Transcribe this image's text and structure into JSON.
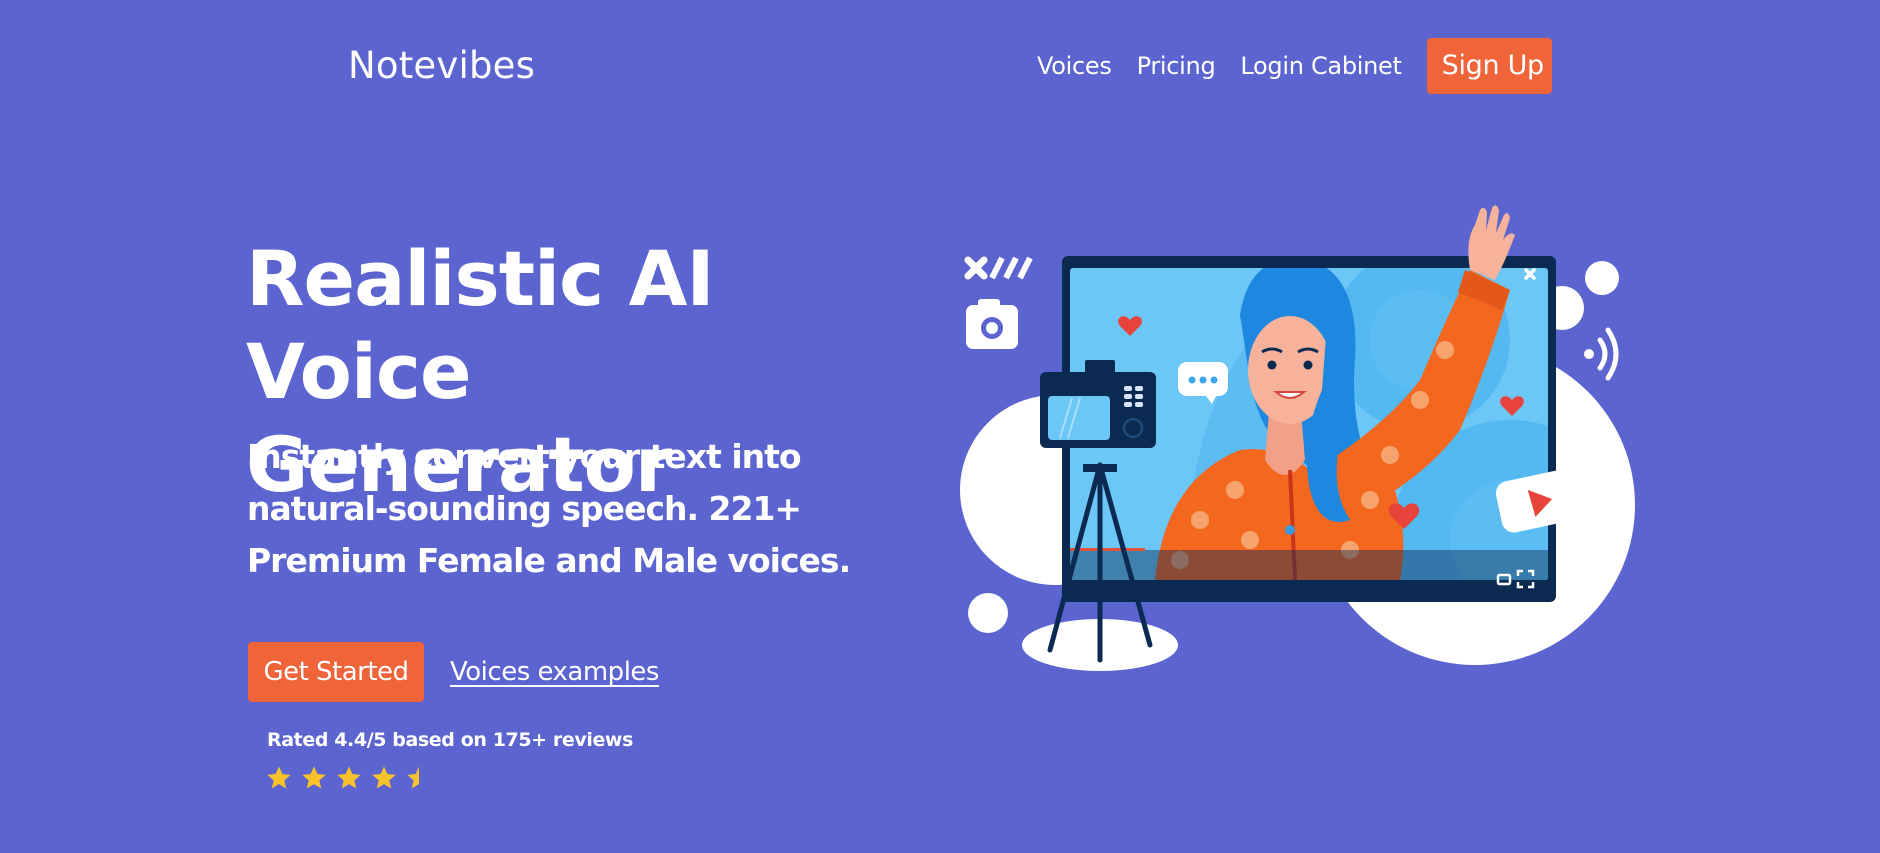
{
  "nav": {
    "logo": "Notevibes",
    "links": [
      "Voices",
      "Pricing",
      "Login Cabinet"
    ],
    "signup_label": "Sign Up"
  },
  "hero": {
    "title_line1": "Realistic AI Voice",
    "title_line2": "Generator",
    "subtitle": "Instantly convert your text into natural-sounding speech. 221+ Premium Female and Male voices.",
    "cta_primary": "Get Started",
    "cta_secondary": "Voices examples",
    "rating_text": "Rated 4.4/5 based on 175+ reviews",
    "rating_value": 4.4,
    "rating_max": 5
  },
  "illustration": {
    "subject": "woman-waving-in-video-window",
    "icons": [
      "close-x-icon",
      "camera-icon",
      "chat-bubble-icon",
      "heart-icon",
      "play-button-icon",
      "broadcast-signal-icon",
      "fullscreen-icon",
      "miniplayer-icon",
      "tripod-camera"
    ]
  },
  "colors": {
    "background": "#5B64CF",
    "accent": "#F0643A",
    "star": "#F8C22A",
    "text": "#FFFFFF"
  }
}
